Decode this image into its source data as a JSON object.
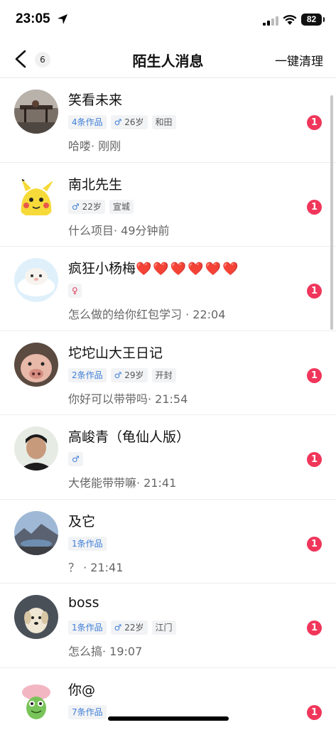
{
  "status_bar": {
    "time": "23:05",
    "battery": "82"
  },
  "nav": {
    "back_count": "6",
    "title": "陌生人消息",
    "clear_label": "一键清理"
  },
  "messages": [
    {
      "name": "笑看未来",
      "tags": {
        "works": "4条作品",
        "gender": "♂",
        "age": "26岁",
        "location": "和田"
      },
      "preview": "哈喽· 刚刚",
      "unread": "1"
    },
    {
      "name": "南北先生",
      "tags": {
        "gender": "♂",
        "age": "22岁",
        "location": "宣城"
      },
      "preview": "什么项目· 49分钟前",
      "unread": "1"
    },
    {
      "name": "疯狂小杨梅",
      "name_emoji": "❤️❤️❤️❤️❤️❤️",
      "tags": {
        "gender": "♀"
      },
      "preview": "怎么做的给你红包学习 · 22:04",
      "unread": "1"
    },
    {
      "name": "坨坨山大王日记",
      "tags": {
        "works": "2条作品",
        "gender": "♂",
        "age": "29岁",
        "location": "开封"
      },
      "preview": "你好可以带带吗· 21:54",
      "unread": "1"
    },
    {
      "name": "高峻青（龟仙人版）",
      "tags": {
        "gender": "♂"
      },
      "preview": "大佬能带带嘛· 21:41",
      "unread": "1"
    },
    {
      "name": "及它",
      "tags": {
        "works": "1条作品"
      },
      "preview": "？ · 21:41",
      "unread": "1"
    },
    {
      "name": "boss",
      "tags": {
        "works": "1条作品",
        "gender": "♂",
        "age": "22岁",
        "location": "江门"
      },
      "preview": "怎么搞· 19:07",
      "unread": "1"
    },
    {
      "name": "你@",
      "tags": {
        "works": "7条作品"
      },
      "preview": "",
      "unread": "1"
    }
  ]
}
